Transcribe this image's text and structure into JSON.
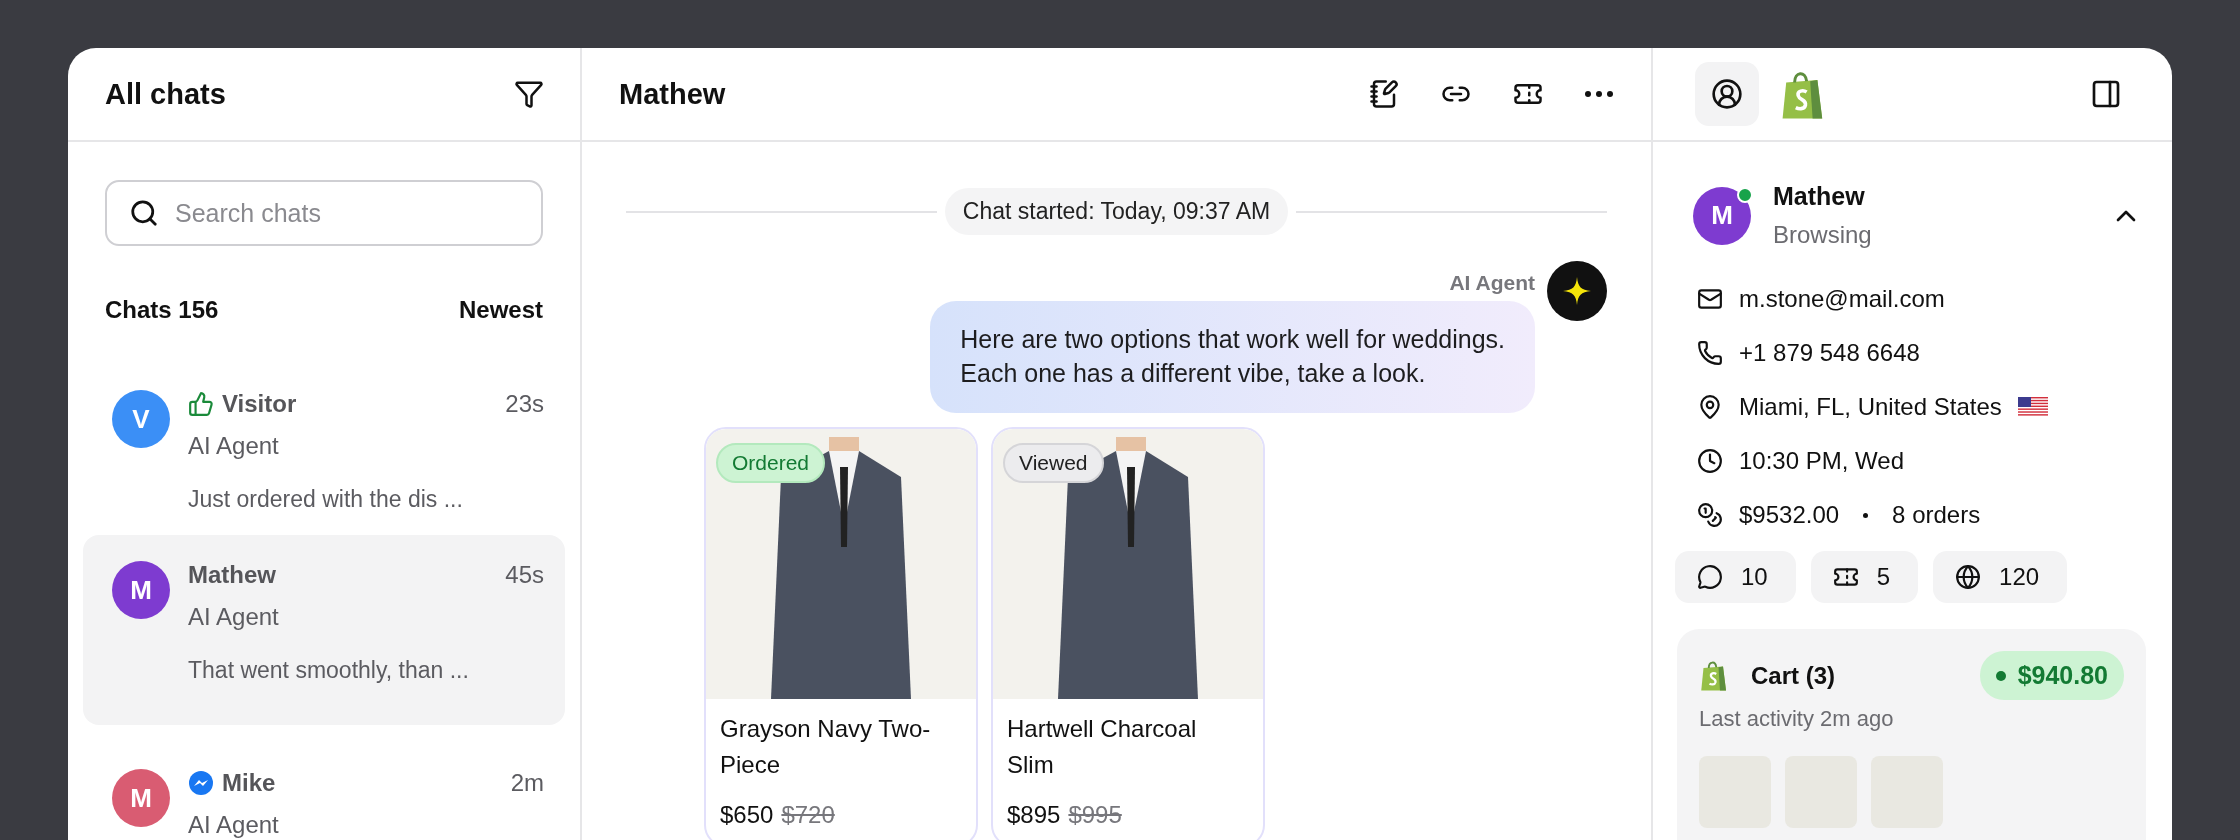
{
  "chat_list": {
    "title": "All chats",
    "search": {
      "placeholder": "Search chats"
    },
    "count_label": "Chats 156",
    "sort": "Newest",
    "items": [
      {
        "initial": "V",
        "color": "#3b8ff6",
        "kind": "rating",
        "name": "Visitor",
        "time": "23s",
        "agent": "AI Agent",
        "preview": "Just ordered with the dis ...",
        "selected": false
      },
      {
        "initial": "M",
        "color": "#7e3bd0",
        "name": "Mathew",
        "time": "45s",
        "agent": "AI Agent",
        "preview": "That went smoothly, than ...",
        "selected": true
      },
      {
        "initial": "M",
        "color": "#d95c72",
        "kind": "messenger",
        "name": "Mike",
        "time": "2m",
        "agent": "AI Agent",
        "selected": false
      }
    ]
  },
  "conversation": {
    "title": "Mathew",
    "started": "Chat started: Today, 09:37 AM",
    "message": {
      "sender": "AI Agent",
      "text": "Here are two options that work well for weddings.\nEach one has a different vibe, take a look."
    },
    "products": [
      {
        "badge": {
          "label": "Ordered",
          "kind": "ordered"
        },
        "name": "Grayson Navy Two-Piece",
        "price": "$650",
        "old_price": "$720"
      },
      {
        "badge": {
          "label": "Viewed",
          "kind": "viewed"
        },
        "name": "Hartwell Charcoal Slim",
        "price": "$895",
        "old_price": "$995"
      }
    ]
  },
  "customer": {
    "initial": "M",
    "name": "Mathew",
    "status": "Browsing",
    "online": true,
    "expanded": true,
    "details": [
      {
        "kind": "email",
        "text": "m.stone@mail.com"
      },
      {
        "kind": "phone",
        "text": "+1 879 548 6648"
      },
      {
        "kind": "location",
        "text": "Miami, FL, United States",
        "flag": true
      },
      {
        "kind": "time",
        "text": "10:30 PM, Wed"
      },
      {
        "kind": "spend",
        "text": "$9532.00",
        "extra": "8 orders"
      }
    ],
    "stats": [
      {
        "kind": "chats",
        "value": "10"
      },
      {
        "kind": "tickets",
        "value": "5"
      },
      {
        "kind": "visits",
        "value": "120"
      }
    ],
    "cart": {
      "title": "Cart (3)",
      "total": "$940.80",
      "activity": "Last activity 2m ago"
    }
  }
}
